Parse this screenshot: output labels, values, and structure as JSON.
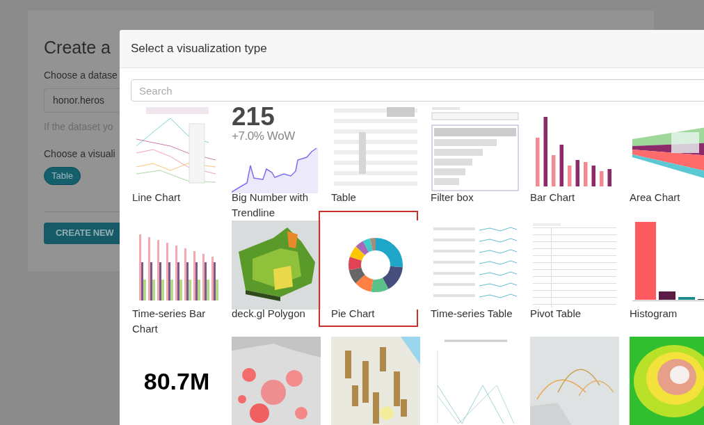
{
  "background_page": {
    "title": "Create a",
    "dataset_label": "Choose a datase",
    "dataset_value": "honor.heros",
    "dataset_hint": "If the dataset yo",
    "viz_label": "Choose a visuali",
    "viz_tag": "Table",
    "create_button": "CREATE NEW"
  },
  "modal": {
    "title": "Select a visualization type",
    "search": {
      "placeholder": "Search"
    },
    "items": [
      {
        "kind": "line",
        "label": "Line Chart",
        "selected": false
      },
      {
        "kind": "big_number",
        "value": "215",
        "subtitle": "+7.0% WoW",
        "label": "Big Number with Trendline",
        "selected": false
      },
      {
        "kind": "table",
        "label": "Table",
        "selected": false
      },
      {
        "kind": "filter",
        "label": "Filter box",
        "selected": false
      },
      {
        "kind": "bar",
        "label": "Bar Chart",
        "selected": false
      },
      {
        "kind": "area",
        "label": "Area Chart",
        "selected": false
      },
      {
        "kind": "ts_bar",
        "label": "Time-series Bar Chart",
        "selected": false
      },
      {
        "kind": "polygon",
        "label": "deck.gl Polygon",
        "selected": false
      },
      {
        "kind": "pie",
        "label": "Pie Chart",
        "selected": true
      },
      {
        "kind": "ts_table",
        "label": "Time-series Table",
        "selected": false
      },
      {
        "kind": "pivot",
        "label": "Pivot Table",
        "selected": false
      },
      {
        "kind": "histogram",
        "label": "Histogram",
        "selected": false
      },
      {
        "kind": "big_number_total",
        "value": "80.7M",
        "selected": false
      },
      {
        "kind": "scatter_map",
        "selected": false
      },
      {
        "kind": "map_3d",
        "selected": false
      },
      {
        "kind": "parallel",
        "selected": false
      },
      {
        "kind": "arcs",
        "selected": false
      },
      {
        "kind": "heatmap",
        "selected": false
      }
    ]
  }
}
